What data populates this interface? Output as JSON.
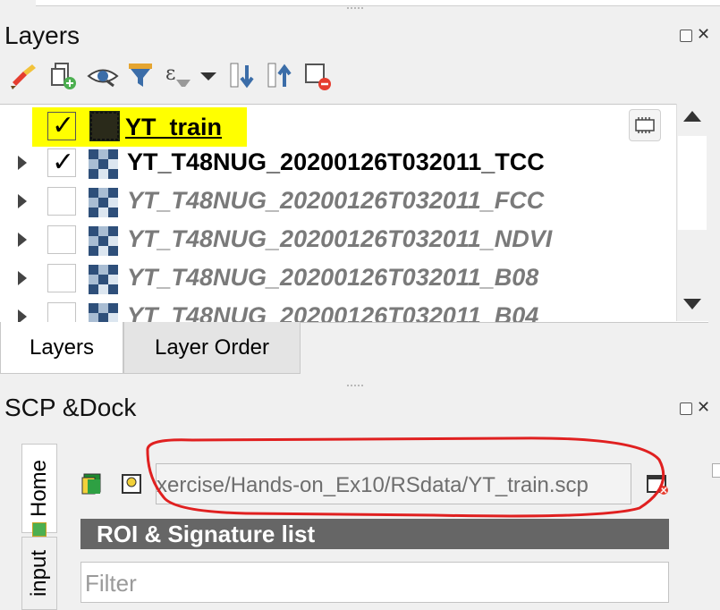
{
  "layers_panel": {
    "title": "Layers",
    "layers": [
      {
        "name": "YT_train",
        "checked": true,
        "active": true,
        "highlighted": true
      },
      {
        "name": "YT_T48NUG_20200126T032011_TCC",
        "checked": true,
        "active": true
      },
      {
        "name": "YT_T48NUG_20200126T032011_FCC",
        "checked": false,
        "active": false
      },
      {
        "name": "YT_T48NUG_20200126T032011_NDVI",
        "checked": false,
        "active": false
      },
      {
        "name": "YT_T48NUG_20200126T032011_B08",
        "checked": false,
        "active": false
      },
      {
        "name": "YT_T48NUG_20200126T032011_B04",
        "checked": false,
        "active": false
      }
    ],
    "tabs": [
      "Layers",
      "Layer Order"
    ],
    "toolbar_icons": [
      "style-brush-icon",
      "add-group-icon",
      "visibility-eye-icon",
      "filter-icon",
      "expression-filter-icon",
      "dropdown-arrow-icon",
      "expand-all-icon",
      "collapse-all-icon",
      "remove-layer-icon"
    ]
  },
  "scp_dock": {
    "title": "SCP &Dock",
    "vertical_tabs": [
      "Home",
      "input"
    ],
    "path_value": "xercise/Hands-on_Ex10/RSdata/YT_train.scp",
    "roi_header": "ROI & Signature list",
    "filter_placeholder": "Filter"
  },
  "colors": {
    "highlight": "#ffff00",
    "annotation_circle": "#e02020",
    "header_bg": "#666666"
  }
}
